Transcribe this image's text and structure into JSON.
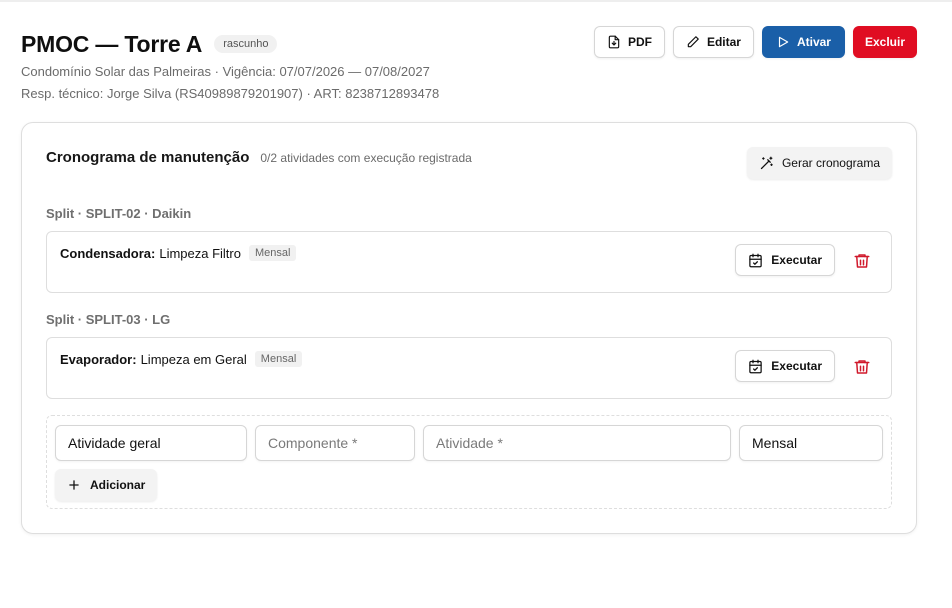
{
  "header": {
    "title": "PMOC — Torre A",
    "status_badge": "rascunho",
    "meta_line1": "Condomínio Solar das Palmeiras · Vigência: 07/07/2026 — 07/08/2027",
    "meta_line2": "Resp. técnico: Jorge Silva (RS40989879201907) · ART: 8238712893478"
  },
  "actions": {
    "pdf_label": "PDF",
    "edit_label": "Editar",
    "activate_label": "Ativar",
    "delete_label": "Excluir"
  },
  "schedule": {
    "title": "Cronograma de manutenção",
    "subtitle": "0/2 atividades com execução registrada",
    "generate_label": "Gerar cronograma",
    "groups": [
      {
        "label": "Split · SPLIT-02 · Daikin",
        "task": {
          "component": "Condensadora:",
          "activity": "Limpeza Filtro",
          "frequency": "Mensal",
          "execute_label": "Executar"
        }
      },
      {
        "label": "Split · SPLIT-03 · LG",
        "task": {
          "component": "Evaporador:",
          "activity": "Limpeza em Geral",
          "frequency": "Mensal",
          "execute_label": "Executar"
        }
      }
    ],
    "new_activity": {
      "scope_value": "Atividade geral",
      "component_placeholder": "Componente *",
      "activity_placeholder": "Atividade *",
      "frequency_value": "Mensal",
      "add_label": "Adicionar"
    }
  },
  "colors": {
    "primary": "#1a5fa8",
    "danger": "#e00d22",
    "trash_icon": "#d0192b"
  },
  "icons": {
    "pdf": "file-download-icon",
    "edit": "pencil-icon",
    "activate": "play-icon",
    "generate": "magic-wand-icon",
    "execute": "calendar-check-icon",
    "remove": "trash-icon",
    "add": "plus-icon"
  }
}
